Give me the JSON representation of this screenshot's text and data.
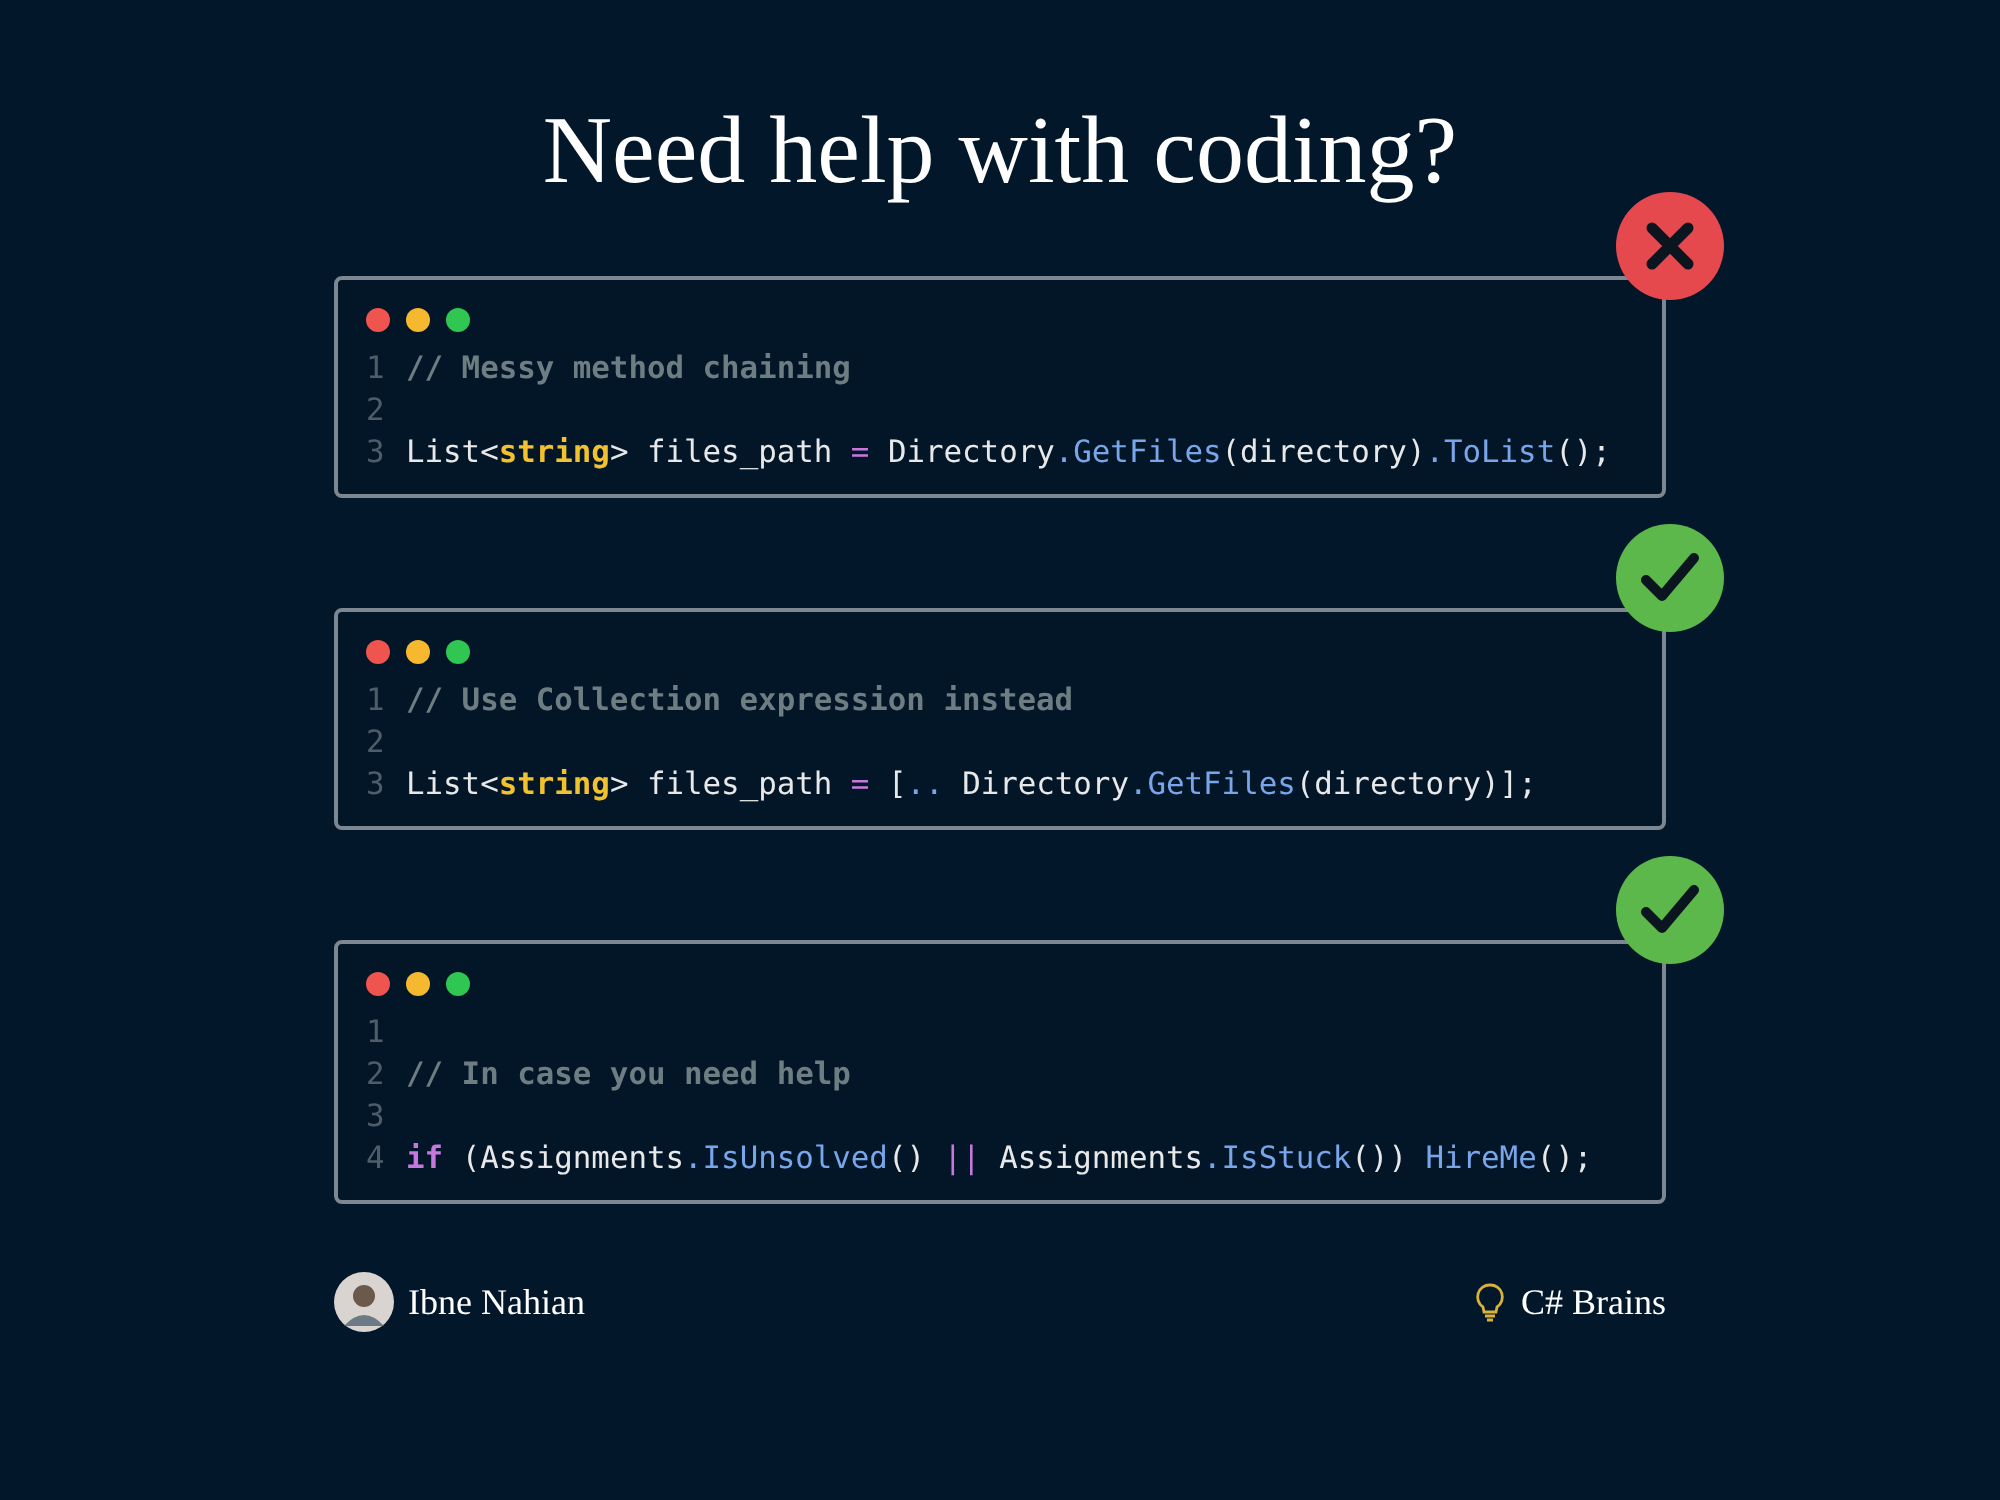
{
  "title": "Need help with coding?",
  "cards": [
    {
      "kind": "bad",
      "lines": [
        {
          "number": "1",
          "tokens": [
            {
              "text": "// Messy method chaining",
              "kind": "comment"
            }
          ]
        },
        {
          "number": "2"
        },
        {
          "number": "3",
          "tokens": [
            {
              "text": "List<",
              "kind": "plain"
            },
            {
              "text": "string",
              "kind": "type"
            },
            {
              "text": "> files_path ",
              "kind": "plain"
            },
            {
              "text": "=",
              "kind": "operator"
            },
            {
              "text": " Directory",
              "kind": "plain"
            },
            {
              "text": ".GetFiles",
              "kind": "method"
            },
            {
              "text": "(directory)",
              "kind": "plain"
            },
            {
              "text": ".ToList",
              "kind": "method"
            },
            {
              "text": "();",
              "kind": "plain"
            }
          ]
        }
      ]
    },
    {
      "kind": "good",
      "lines": [
        {
          "number": "1",
          "tokens": [
            {
              "text": "// Use Collection expression instead",
              "kind": "comment"
            }
          ]
        },
        {
          "number": "2"
        },
        {
          "number": "3",
          "tokens": [
            {
              "text": "List<",
              "kind": "plain"
            },
            {
              "text": "string",
              "kind": "type"
            },
            {
              "text": "> files_path ",
              "kind": "plain"
            },
            {
              "text": "=",
              "kind": "operator"
            },
            {
              "text": " [",
              "kind": "plain"
            },
            {
              "text": "..",
              "kind": "method"
            },
            {
              "text": " Directory",
              "kind": "plain"
            },
            {
              "text": ".GetFiles",
              "kind": "method"
            },
            {
              "text": "(directory)];",
              "kind": "plain"
            }
          ]
        }
      ]
    },
    {
      "kind": "good",
      "lines": [
        {
          "number": "1"
        },
        {
          "number": "2",
          "tokens": [
            {
              "text": "// In case you need help",
              "kind": "comment"
            }
          ]
        },
        {
          "number": "3"
        },
        {
          "number": "4",
          "tokens": [
            {
              "text": "if",
              "kind": "keyword"
            },
            {
              "text": " (Assignments",
              "kind": "plain"
            },
            {
              "text": ".IsUnsolved",
              "kind": "method"
            },
            {
              "text": "() ",
              "kind": "plain"
            },
            {
              "text": "||",
              "kind": "operator"
            },
            {
              "text": " Assignments",
              "kind": "plain"
            },
            {
              "text": ".IsStuck",
              "kind": "method"
            },
            {
              "text": "()) ",
              "kind": "plain"
            },
            {
              "text": "HireMe",
              "kind": "method"
            },
            {
              "text": "();",
              "kind": "plain"
            }
          ]
        }
      ]
    }
  ],
  "footer": {
    "author": "Ibne Nahian",
    "brand": "C# Brains"
  }
}
